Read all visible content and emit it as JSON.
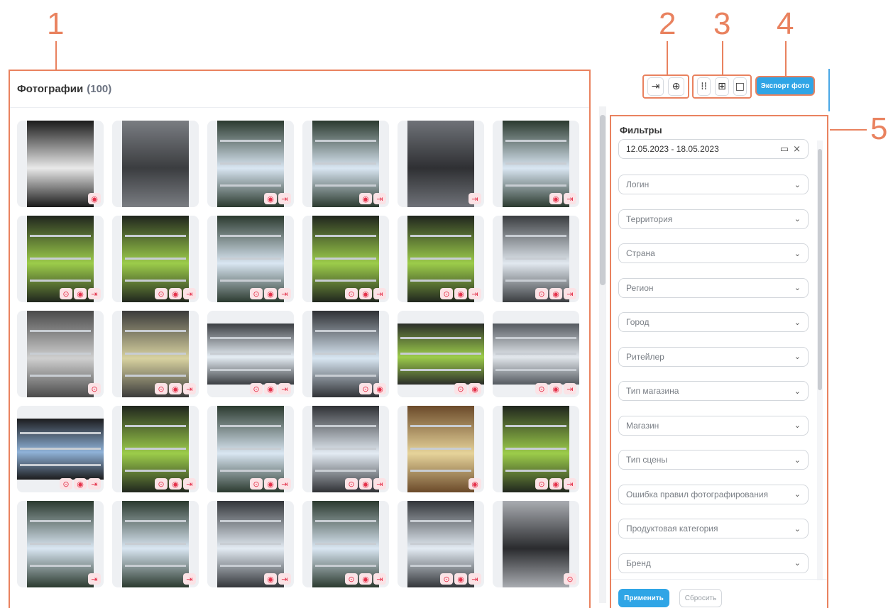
{
  "callouts": [
    "1",
    "2",
    "3",
    "4",
    "5"
  ],
  "photos": {
    "title": "Фотографии",
    "count": "(100)"
  },
  "toolbar": {
    "zoom_out_icon": "zoom-out-icon",
    "zoom_in_icon": "zoom-in-icon",
    "grid_small_icon": "grid-small-icon",
    "grid_large_icon": "grid-large-icon",
    "single_view_icon": "single-view-icon",
    "export_label": "Экспорт фото"
  },
  "filters": {
    "title": "Фильтры",
    "date_value": "12.05.2023 - 18.05.2023",
    "fields": [
      "Логин",
      "Территория",
      "Страна",
      "Регион",
      "Город",
      "Ритейлер",
      "Тип магазина",
      "Магазин",
      "Тип сцены",
      "Ошибка правил фотографирования",
      "Продуктовая категория",
      "Бренд"
    ],
    "apply_label": "Применить",
    "reset_label": "Сбросить"
  },
  "colors": {
    "accent": "#e9825f",
    "primary": "#2fa5e6",
    "badge": "#e5314a"
  }
}
